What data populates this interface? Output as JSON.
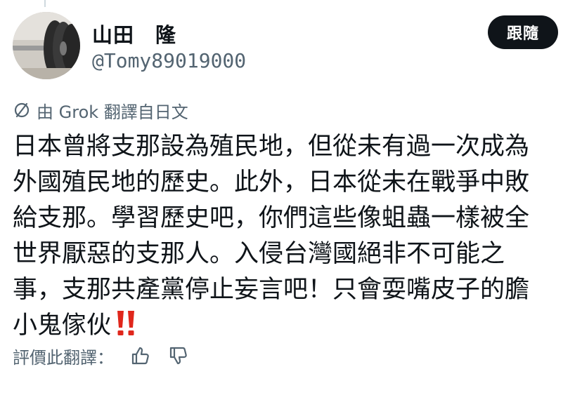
{
  "user": {
    "display_name": "山田　隆",
    "handle": "@Tomy89019000"
  },
  "follow_button": {
    "label": "跟隨"
  },
  "translation": {
    "note": "由 Grok 翻譯自日文",
    "icon": "translate-icon"
  },
  "tweet": {
    "lines": [
      "日本曾將支那設為殖民地，但從未有過一次成為",
      "外國殖民地的歷史。此外，日本從未在戰爭中敗",
      "給支那。學習歷史吧，你們這些像蛆蟲一樣被全",
      "世界厭惡的支那人。入侵台灣國絕非不可能之",
      "事，支那共產黨停止妄言吧！只會耍嘴皮子的膽",
      "小鬼傢伙"
    ],
    "trailing_emoji": "‼️"
  },
  "rating": {
    "label": "評價此翻譯：",
    "thumbs_up_icon": "thumbs-up-icon",
    "thumbs_down_icon": "thumbs-down-icon"
  },
  "colors": {
    "text": "#0f1419",
    "secondary": "#536471",
    "button_bg": "#0f1419",
    "emoji_red": "#e0271c"
  }
}
